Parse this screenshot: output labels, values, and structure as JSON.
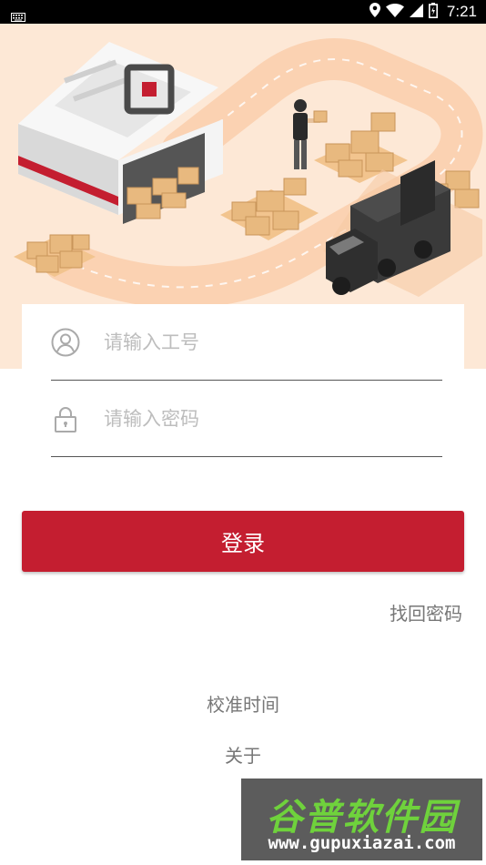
{
  "status_bar": {
    "time": "7:21",
    "icons": [
      "keyboard-icon",
      "location-icon",
      "wifi-icon",
      "signal-icon",
      "battery-icon"
    ]
  },
  "hero": {
    "description_icons": [
      "warehouse",
      "worker",
      "boxes",
      "truck"
    ]
  },
  "login_form": {
    "account_placeholder": "请输入工号",
    "password_placeholder": "请输入密码",
    "account_value": "",
    "password_value": ""
  },
  "actions": {
    "login_label": "登录",
    "forgot_password_label": "找回密码",
    "calibrate_time_label": "校准时间",
    "about_label": "关于"
  },
  "watermark": {
    "title": "谷普软件园",
    "url": "www.gupuxiazai.com"
  },
  "colors": {
    "primary": "#c41e30",
    "hero_bg": "#fde8d6",
    "status_bar": "#000000",
    "link_text": "#777777"
  }
}
